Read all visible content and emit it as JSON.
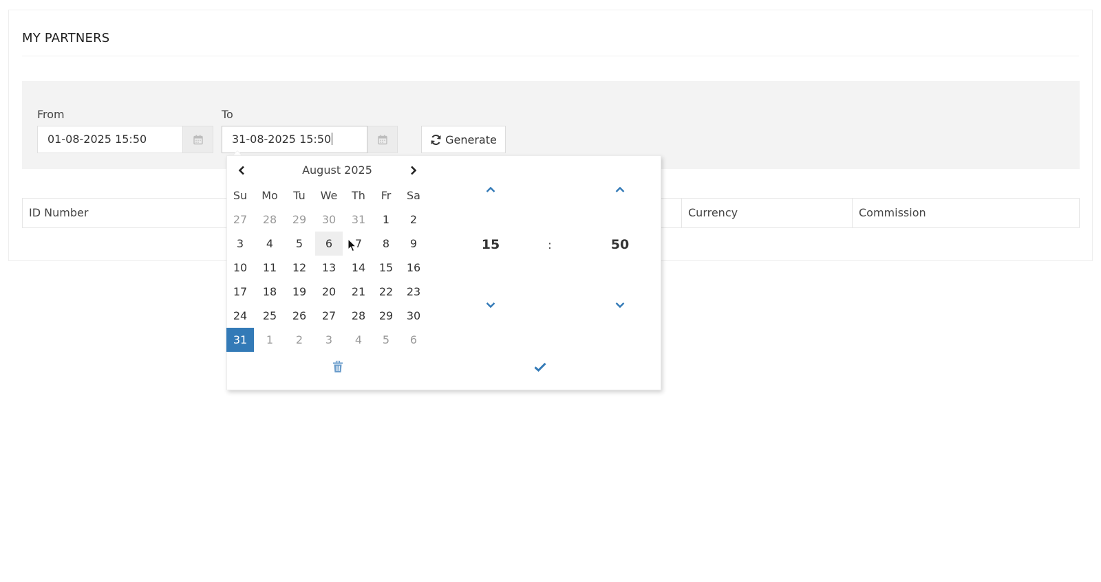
{
  "panel": {
    "title": "MY PARTNERS"
  },
  "filters": {
    "from_label": "From",
    "from_value": "01-08-2025 15:50",
    "to_label": "To",
    "to_value": "31-08-2025 15:50",
    "generate_label": "Generate"
  },
  "table": {
    "headers": [
      "ID Number",
      "Currency",
      "Commission"
    ]
  },
  "datepicker": {
    "month_title": "August 2025",
    "weekdays": [
      "Su",
      "Mo",
      "Tu",
      "We",
      "Th",
      "Fr",
      "Sa"
    ],
    "weeks": [
      [
        "27",
        "28",
        "29",
        "30",
        "31",
        "1",
        "2"
      ],
      [
        "3",
        "4",
        "5",
        "6",
        "7",
        "8",
        "9"
      ],
      [
        "10",
        "11",
        "12",
        "13",
        "14",
        "15",
        "16"
      ],
      [
        "17",
        "18",
        "19",
        "20",
        "21",
        "22",
        "23"
      ],
      [
        "24",
        "25",
        "26",
        "27",
        "28",
        "29",
        "30"
      ],
      [
        "31",
        "1",
        "2",
        "3",
        "4",
        "5",
        "6"
      ]
    ],
    "selected_day": "31",
    "hovered_day": "6",
    "time": {
      "hours": "15",
      "separator": ":",
      "minutes": "50"
    }
  },
  "colors": {
    "accent": "#337ab7",
    "panel_bg": "#f3f3f3",
    "muted_text": "#999999"
  },
  "icons": {
    "from_addon": "calendar-icon",
    "to_addon": "calendar-icon",
    "generate": "refresh-icon",
    "prev": "chevron-left-icon",
    "next": "chevron-right-icon",
    "increment": "chevron-up-icon",
    "decrement": "chevron-down-icon",
    "clear": "trash-icon",
    "close": "check-icon"
  }
}
